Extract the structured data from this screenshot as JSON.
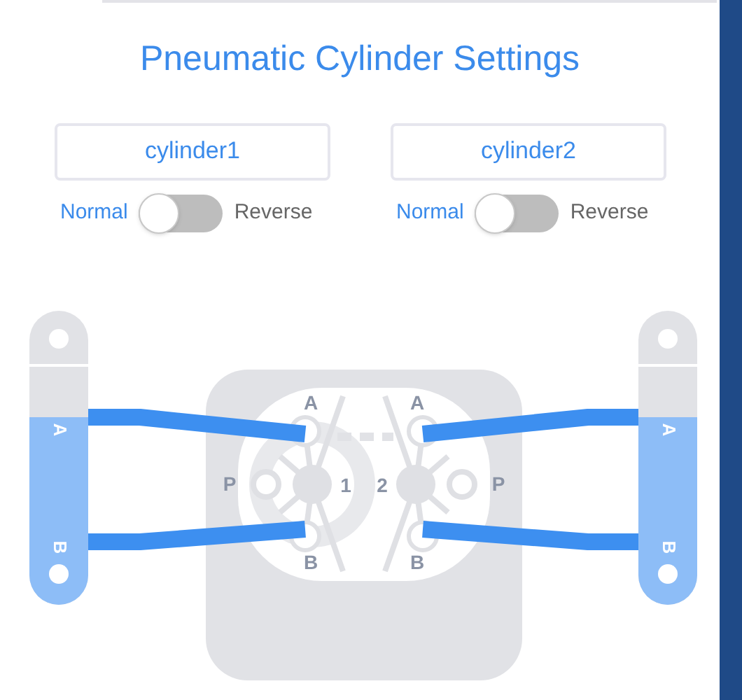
{
  "title": "Pneumatic Cylinder Settings",
  "cylinders": [
    {
      "name": "cylinder1",
      "left_label": "Normal",
      "right_label": "Reverse",
      "on": false
    },
    {
      "name": "cylinder2",
      "left_label": "Normal",
      "right_label": "Reverse",
      "on": false
    }
  ],
  "diagram": {
    "cylinders": [
      {
        "port_a": "A",
        "port_b": "B"
      },
      {
        "port_a": "A",
        "port_b": "B"
      }
    ],
    "valves": [
      {
        "number": "1",
        "port_a": "A",
        "port_b": "B",
        "port_p": "P"
      },
      {
        "number": "2",
        "port_a": "A",
        "port_b": "B",
        "port_p": "P"
      }
    ]
  }
}
